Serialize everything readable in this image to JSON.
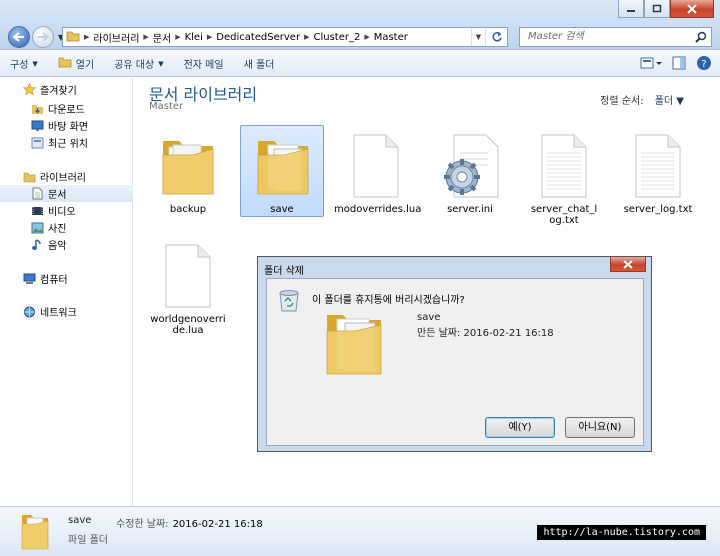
{
  "window": {
    "minimize_icon": "minimize-icon",
    "maximize_icon": "maximize-icon",
    "close_icon": "close-icon"
  },
  "address": {
    "segments": [
      "라이브러리",
      "문서",
      "Klei",
      "DedicatedServer",
      "Cluster_2",
      "Master"
    ]
  },
  "search": {
    "placeholder": "Master 검색"
  },
  "toolbar": {
    "organize": "구성",
    "open": "열기",
    "share": "공유 대상",
    "email": "전자 메일",
    "new_folder": "새 폴더"
  },
  "sidebar": {
    "favorites": "즐겨찾기",
    "downloads": "다운로드",
    "desktop": "바탕 화면",
    "recent": "최근 위치",
    "libraries": "라이브러리",
    "documents": "문서",
    "videos": "비디오",
    "pictures": "사진",
    "music": "음악",
    "computer": "컴퓨터",
    "network": "네트워크"
  },
  "library": {
    "title": "문서 라이브러리",
    "subtitle": "Master",
    "arrange_label": "정렬 순서:",
    "arrange_value": "폴더"
  },
  "files": [
    {
      "name": "backup",
      "type": "folder"
    },
    {
      "name": "save",
      "type": "folder"
    },
    {
      "name": "modoverrides.lua",
      "type": "blank"
    },
    {
      "name": "server.ini",
      "type": "settings"
    },
    {
      "name": "server_chat_log.txt",
      "type": "text"
    },
    {
      "name": "server_log.txt",
      "type": "text"
    },
    {
      "name": "worldgenoverride.lua",
      "type": "blank"
    }
  ],
  "dialog": {
    "title": "폴더 삭제",
    "question": "이 폴더를 휴지통에 버리시겠습니까?",
    "item_name": "save",
    "item_date": "만든 날짜: 2016-02-21 16:18",
    "yes": "예(Y)",
    "no": "아니요(N)"
  },
  "status": {
    "name": "save",
    "type": "파일 폴더",
    "modified_label": "수정한 날짜:",
    "modified_value": "2016-02-21 16:18"
  },
  "watermark": "http://la-nube.tistory.com"
}
